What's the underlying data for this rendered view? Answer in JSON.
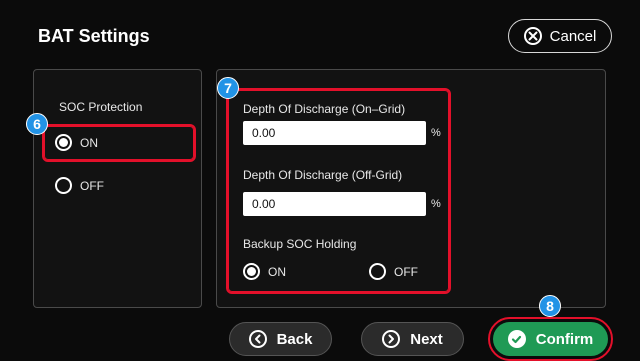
{
  "header": {
    "title": "BAT Settings",
    "cancel_label": "Cancel"
  },
  "soc_protection": {
    "label": "SOC Protection",
    "options": [
      {
        "label": "ON",
        "selected": true
      },
      {
        "label": "OFF",
        "selected": false
      }
    ]
  },
  "depth_of_discharge": {
    "on_grid_label": "Depth Of Discharge  (On–Grid)",
    "on_grid_value": "0.00",
    "off_grid_label": "Depth Of Discharge  (Off-Grid)",
    "off_grid_value": "0.00",
    "unit": "%"
  },
  "backup_soc_holding": {
    "label": "Backup SOC Holding",
    "options": [
      {
        "label": "ON",
        "selected": true
      },
      {
        "label": "OFF",
        "selected": false
      }
    ]
  },
  "footer": {
    "back_label": "Back",
    "next_label": "Next",
    "confirm_label": "Confirm"
  },
  "annotations": {
    "badge_6": "6",
    "badge_7": "7",
    "badge_8": "8"
  },
  "colors": {
    "highlight": "#e3102a",
    "badge": "#2293e6",
    "confirm": "#1f9a55"
  },
  "icons": [
    "close-circle-icon",
    "chevron-left-circle-icon",
    "chevron-right-circle-icon",
    "check-circle-icon"
  ]
}
